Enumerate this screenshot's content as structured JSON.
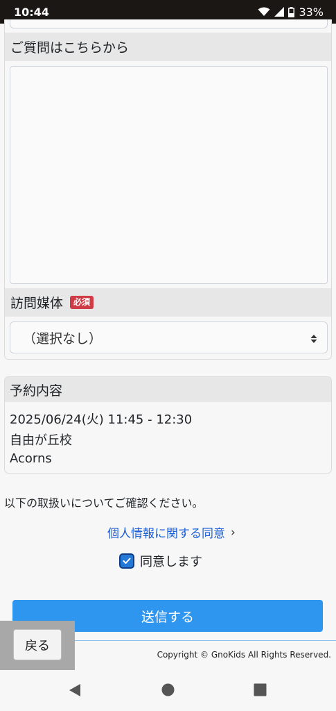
{
  "status_bar": {
    "time": "10:44",
    "battery": "33%"
  },
  "form": {
    "question_label": "ご質問はこちらから",
    "question_value": "",
    "media_label": "訪問媒体",
    "required_badge": "必須",
    "media_selected": "（選択なし）"
  },
  "reservation": {
    "title": "予約内容",
    "datetime": "2025/06/24(火) 11:45 - 12:30",
    "school": "自由が丘校",
    "course": "Acorns"
  },
  "consent": {
    "notice": "以下の取扱いについてご確認ください。",
    "link_label": "個人情報に関する同意",
    "link_chevron": "›",
    "agree_label": "同意します",
    "agreed": true
  },
  "buttons": {
    "submit": "送信する",
    "back": "戻る"
  },
  "footer": {
    "copyright": "Copyright © GnoKids All Rights Reserved."
  },
  "colors": {
    "accent": "#2f96ef",
    "link": "#1a5fd8",
    "required": "#d03c45",
    "checkbox": "#2479d6"
  },
  "icons": [
    "wifi-icon",
    "cellular-icon",
    "battery-icon",
    "select-arrows-icon",
    "check-icon",
    "nav-back-icon",
    "nav-home-icon",
    "nav-recents-icon"
  ]
}
